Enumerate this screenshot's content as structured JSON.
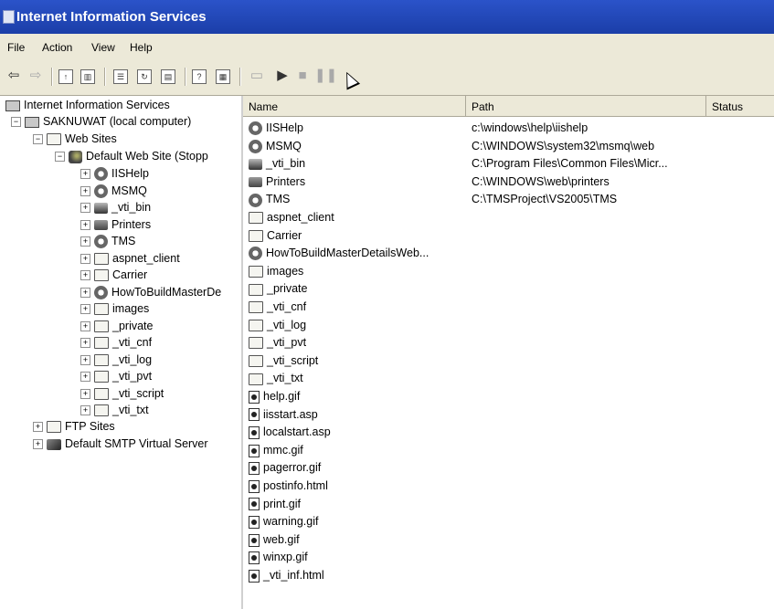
{
  "window": {
    "title": "Internet Information Services"
  },
  "menu": [
    "File",
    "Action",
    "View",
    "Help"
  ],
  "tree": {
    "root": "Internet Information Services",
    "computer": "SAKNUWAT (local computer)",
    "web_sites": "Web Sites",
    "default_site": "Default Web Site (Stopp",
    "children": [
      {
        "label": "IISHelp",
        "icon": "gear"
      },
      {
        "label": "MSMQ",
        "icon": "gear"
      },
      {
        "label": "_vti_bin",
        "icon": "vtibin"
      },
      {
        "label": "Printers",
        "icon": "printer"
      },
      {
        "label": "TMS",
        "icon": "gear"
      },
      {
        "label": "aspnet_client",
        "icon": "folder"
      },
      {
        "label": "Carrier",
        "icon": "folder"
      },
      {
        "label": "HowToBuildMasterDe",
        "icon": "gear"
      },
      {
        "label": "images",
        "icon": "folder"
      },
      {
        "label": "_private",
        "icon": "folder"
      },
      {
        "label": "_vti_cnf",
        "icon": "folder"
      },
      {
        "label": "_vti_log",
        "icon": "folder"
      },
      {
        "label": "_vti_pvt",
        "icon": "folder"
      },
      {
        "label": "_vti_script",
        "icon": "folder"
      },
      {
        "label": "_vti_txt",
        "icon": "folder"
      }
    ],
    "ftp_sites": "FTP Sites",
    "smtp": "Default SMTP Virtual Server"
  },
  "columns": {
    "name": "Name",
    "path": "Path",
    "status": "Status"
  },
  "rows": [
    {
      "name": "IISHelp",
      "path": "c:\\windows\\help\\iishelp",
      "icon": "gear"
    },
    {
      "name": "MSMQ",
      "path": "C:\\WINDOWS\\system32\\msmq\\web",
      "icon": "gear"
    },
    {
      "name": "_vti_bin",
      "path": "C:\\Program Files\\Common Files\\Micr...",
      "icon": "vtibin"
    },
    {
      "name": "Printers",
      "path": "C:\\WINDOWS\\web\\printers",
      "icon": "printer"
    },
    {
      "name": "TMS",
      "path": "C:\\TMSProject\\VS2005\\TMS",
      "icon": "gear"
    },
    {
      "name": "aspnet_client",
      "path": "",
      "icon": "folder"
    },
    {
      "name": "Carrier",
      "path": "",
      "icon": "folder"
    },
    {
      "name": "HowToBuildMasterDetailsWeb...",
      "path": "",
      "icon": "gear"
    },
    {
      "name": "images",
      "path": "",
      "icon": "folder"
    },
    {
      "name": "_private",
      "path": "",
      "icon": "folder"
    },
    {
      "name": "_vti_cnf",
      "path": "",
      "icon": "folder"
    },
    {
      "name": "_vti_log",
      "path": "",
      "icon": "folder"
    },
    {
      "name": "_vti_pvt",
      "path": "",
      "icon": "folder"
    },
    {
      "name": "_vti_script",
      "path": "",
      "icon": "folder"
    },
    {
      "name": "_vti_txt",
      "path": "",
      "icon": "folder"
    },
    {
      "name": "help.gif",
      "path": "",
      "icon": "file"
    },
    {
      "name": "iisstart.asp",
      "path": "",
      "icon": "file"
    },
    {
      "name": "localstart.asp",
      "path": "",
      "icon": "file"
    },
    {
      "name": "mmc.gif",
      "path": "",
      "icon": "file"
    },
    {
      "name": "pagerror.gif",
      "path": "",
      "icon": "file"
    },
    {
      "name": "postinfo.html",
      "path": "",
      "icon": "file"
    },
    {
      "name": "print.gif",
      "path": "",
      "icon": "file"
    },
    {
      "name": "warning.gif",
      "path": "",
      "icon": "file"
    },
    {
      "name": "web.gif",
      "path": "",
      "icon": "file"
    },
    {
      "name": "winxp.gif",
      "path": "",
      "icon": "file"
    },
    {
      "name": "_vti_inf.html",
      "path": "",
      "icon": "file"
    }
  ],
  "colors": {
    "titlebar": "#2b53c9",
    "chrome": "#ece9d8"
  }
}
